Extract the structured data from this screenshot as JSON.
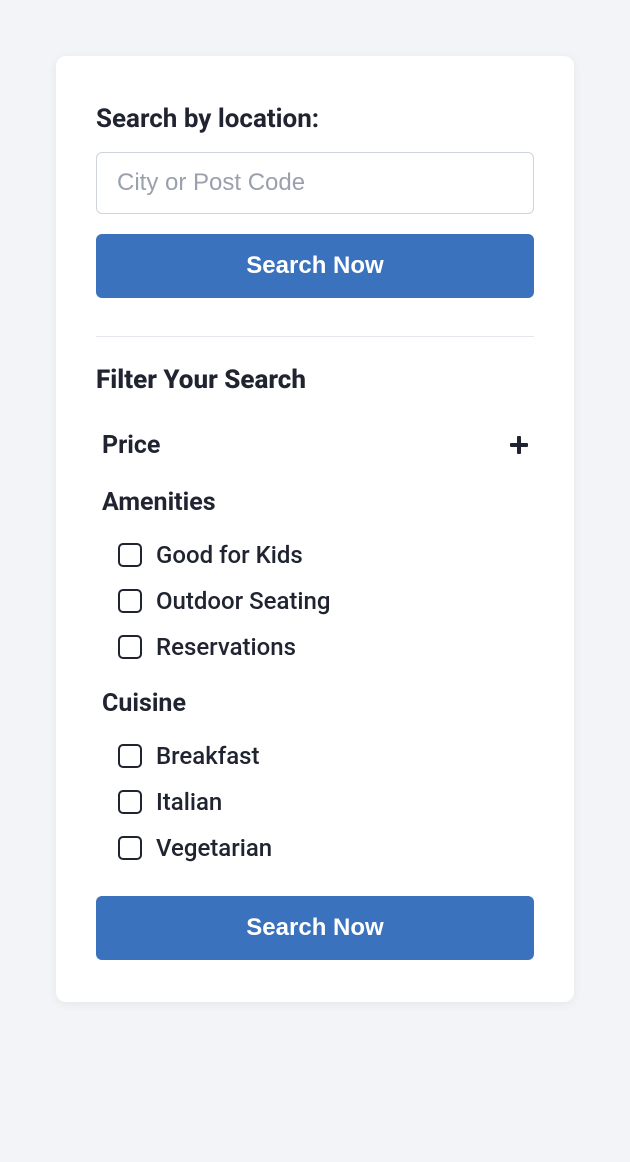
{
  "search": {
    "label": "Search by location:",
    "placeholder": "City or Post Code",
    "button": "Search Now"
  },
  "filter": {
    "heading": "Filter Your Search",
    "sections": [
      {
        "title": "Price",
        "expanded": false,
        "options": []
      },
      {
        "title": "Amenities",
        "expanded": true,
        "options": [
          {
            "label": "Good for Kids",
            "checked": false
          },
          {
            "label": "Outdoor Seating",
            "checked": false
          },
          {
            "label": "Reservations",
            "checked": false
          }
        ]
      },
      {
        "title": "Cuisine",
        "expanded": true,
        "options": [
          {
            "label": "Breakfast",
            "checked": false
          },
          {
            "label": "Italian",
            "checked": false
          },
          {
            "label": "Vegetarian",
            "checked": false
          }
        ]
      }
    ],
    "submit": "Search Now"
  }
}
